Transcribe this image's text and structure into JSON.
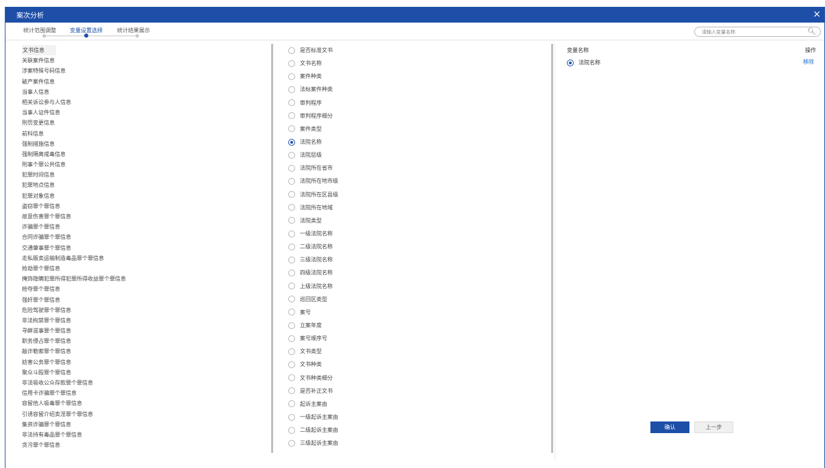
{
  "window": {
    "title": "案次分析",
    "close_glyph": "×"
  },
  "tabs": [
    {
      "label": "统计范围调整",
      "active": false
    },
    {
      "label": "变量设置选择",
      "active": true
    },
    {
      "label": "统计结果展示",
      "active": false
    }
  ],
  "search": {
    "placeholder": "请输入变量名称",
    "icon": "search-icon"
  },
  "left_list": [
    "文书信息",
    "关联案件信息",
    "涉案特殊号码信息",
    "破产案件信息",
    "当事人信息",
    "相关诉讼参与人信息",
    "当事人证件信息",
    "刑罚变更信息",
    "前科信息",
    "强制措施信息",
    "强制隔离戒毒信息",
    "刑事个罪公共信息",
    "犯罪时间信息",
    "犯罪地点信息",
    "犯罪对象信息",
    "盗窃罪个罪信息",
    "故意伤害罪个罪信息",
    "诈骗罪个罪信息",
    "合同诈骗罪个罪信息",
    "交通肇事罪个罪信息",
    "走私贩卖运输制造毒品罪个罪信息",
    "抢劫罪个罪信息",
    "掩饰隐瞒犯罪所得犯罪所得收益罪个罪信息",
    "抢夺罪个罪信息",
    "强奸罪个罪信息",
    "危险驾驶罪个罪信息",
    "非法拘禁罪个罪信息",
    "寻衅滋事罪个罪信息",
    "职务侵占罪个罪信息",
    "敲诈勒索罪个罪信息",
    "妨害公务罪个罪信息",
    "聚众斗殴罪个罪信息",
    "非法吸收公众存款罪个罪信息",
    "信用卡诈骗罪个罪信息",
    "容留他人吸毒罪个罪信息",
    "引诱容留介绍卖淫罪个罪信息",
    "集资诈骗罪个罪信息",
    "非法持有毒品罪个罪信息",
    "贪污罪个罪信息"
  ],
  "mid_list": [
    {
      "label": "是否标准文书",
      "checked": false
    },
    {
      "label": "文书名称",
      "checked": false
    },
    {
      "label": "案件种类",
      "checked": false
    },
    {
      "label": "法标案件种类",
      "checked": false
    },
    {
      "label": "审判程序",
      "checked": false
    },
    {
      "label": "审判程序细分",
      "checked": false
    },
    {
      "label": "案件类型",
      "checked": false
    },
    {
      "label": "法院名称",
      "checked": true
    },
    {
      "label": "法院层级",
      "checked": false
    },
    {
      "label": "法院所在省市",
      "checked": false
    },
    {
      "label": "法院所在地市级",
      "checked": false
    },
    {
      "label": "法院所在区县级",
      "checked": false
    },
    {
      "label": "法院所在地域",
      "checked": false
    },
    {
      "label": "法院类型",
      "checked": false
    },
    {
      "label": "一级法院名称",
      "checked": false
    },
    {
      "label": "二级法院名称",
      "checked": false
    },
    {
      "label": "三级法院名称",
      "checked": false
    },
    {
      "label": "四级法院名称",
      "checked": false
    },
    {
      "label": "上级法院名称",
      "checked": false
    },
    {
      "label": "巡回区类型",
      "checked": false
    },
    {
      "label": "案号",
      "checked": false
    },
    {
      "label": "立案年度",
      "checked": false
    },
    {
      "label": "案号顺序号",
      "checked": false
    },
    {
      "label": "文书类型",
      "checked": false
    },
    {
      "label": "文书种类",
      "checked": false
    },
    {
      "label": "文书种类细分",
      "checked": false
    },
    {
      "label": "是否补正文书",
      "checked": false
    },
    {
      "label": "起诉主案由",
      "checked": false
    },
    {
      "label": "一级起诉主案由",
      "checked": false
    },
    {
      "label": "二级起诉主案由",
      "checked": false
    },
    {
      "label": "三级起诉主案由",
      "checked": false
    }
  ],
  "right_panel": {
    "header_name": "变量名称",
    "header_op": "操作",
    "selected": [
      {
        "label": "法院名称",
        "action": "移除"
      }
    ]
  },
  "buttons": {
    "confirm": "确认",
    "prev": "上一步"
  },
  "colors": {
    "primary": "#1d4fa8",
    "link": "#1d6fd0"
  }
}
